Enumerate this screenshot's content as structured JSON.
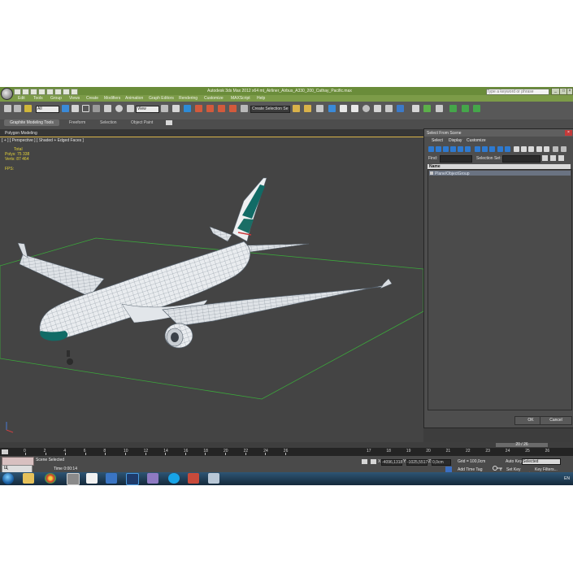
{
  "app": {
    "title": "Autodesk 3ds Max 2012 x64     mt_Airliner_Airbus_A330_200_Cathay_Pacific.max",
    "search_placeholder": "Type a keyword or phrase"
  },
  "menu": [
    "Edit",
    "Tools",
    "Group",
    "Views",
    "Create",
    "Modifiers",
    "Animation",
    "Graph Editors",
    "Rendering",
    "Customize",
    "MAXScript",
    "Help"
  ],
  "toolbar": {
    "selection_filter": "All",
    "reference_coord": "View",
    "named_selection": "Create Selection Se"
  },
  "ribbon": {
    "tabs": [
      "Graphite Modeling Tools",
      "Freeform",
      "Selection",
      "Object Paint"
    ],
    "panel": "Polygon Modeling"
  },
  "viewport": {
    "label": "[ + ] [ Perspective ] [ Shaded + Edged Faces ]",
    "stats": {
      "header": "Total",
      "polys_label": "Polys:",
      "polys_value": "75 338",
      "verts_label": "Verts:",
      "verts_value": "87 464",
      "fps_label": "FPS:"
    }
  },
  "select_dialog": {
    "title": "Select From Scene",
    "menu": [
      "Select",
      "Display",
      "Customize"
    ],
    "find_label": "Find:",
    "selection_set_label": "Selection Set:",
    "column_name": "Name",
    "rows": [
      "Plane/ObjectGroup"
    ],
    "ok": "OK",
    "cancel": "Cancel"
  },
  "timeline": {
    "slider": "20 / 26",
    "ticks": [
      "0",
      "2",
      "4",
      "6",
      "8",
      "10",
      "12",
      "14",
      "16",
      "18",
      "20",
      "22",
      "24",
      "26"
    ],
    "ticks_right": [
      "17",
      "18",
      "19",
      "20",
      "21",
      "22",
      "23",
      "24",
      "25",
      "26"
    ]
  },
  "status": {
    "scene_selected": "Scene Selected",
    "time": "Time  0:00:14",
    "x_label": "X:",
    "x_value": "-4096,1318",
    "y_label": "Y:",
    "y_value": "-1025,5517",
    "z_label": "Z:",
    "z_value": "0,0cm",
    "grid": "Grid = 100,0cm",
    "add_time_tag": "Add Time Tag",
    "auto_key": "Auto Key",
    "auto_key_value": "Selected",
    "set_key": "Set Key",
    "key_filters": "Key Filters..."
  },
  "taskbar": {
    "language": "EN"
  },
  "colors": {
    "titlebar": "#6a8c3a",
    "viewport_bg": "#444444",
    "grid_green": "#3ba83b",
    "livery_teal": "#116b66"
  }
}
